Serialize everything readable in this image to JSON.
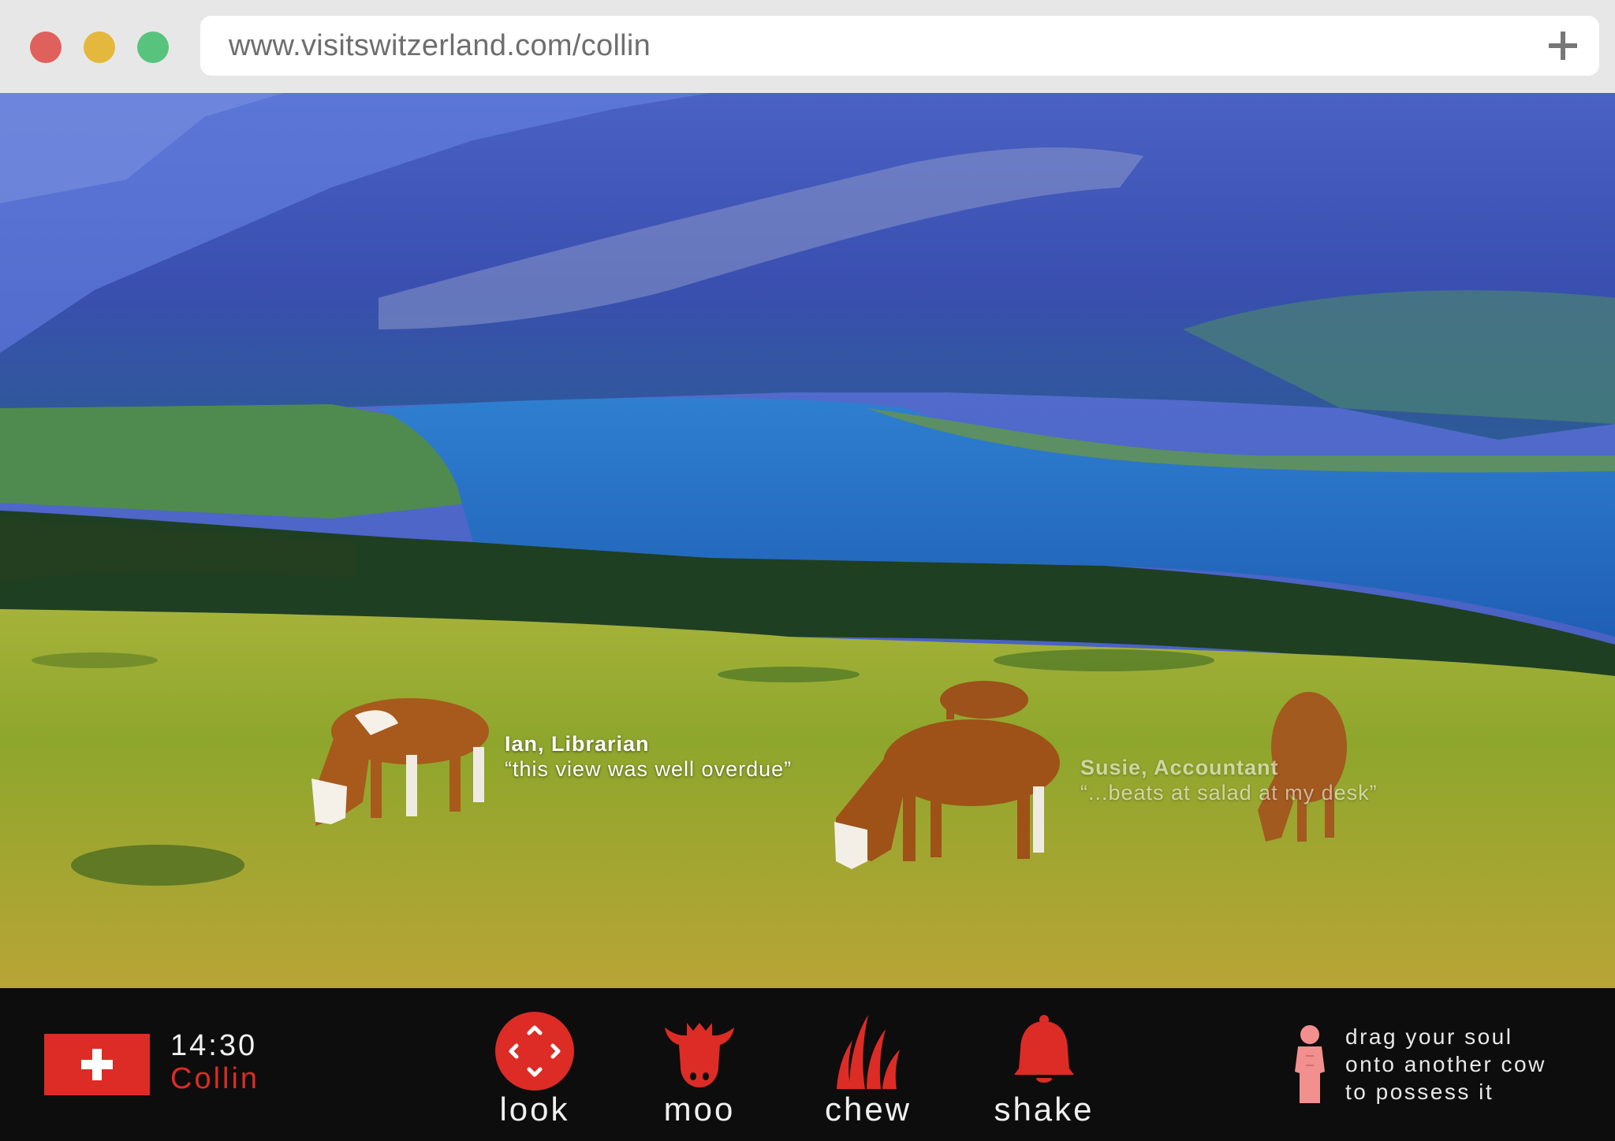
{
  "browser": {
    "url": "www.visitswitzerland.com/collin",
    "window_buttons": [
      "close",
      "minimize",
      "maximize"
    ],
    "new_tab_icon": "plus-icon"
  },
  "scene": {
    "captions": [
      {
        "name": "Ian, Librarian",
        "quote": "“this view was well overdue”"
      },
      {
        "name": "Susie, Accountant",
        "quote": "“...beats at salad at my desk”"
      }
    ]
  },
  "toolbar": {
    "flag_icon": "swiss-flag-icon",
    "time": "14:30",
    "user": "Collin",
    "actions": [
      {
        "label": "look",
        "icon": "look-target-icon"
      },
      {
        "label": "moo",
        "icon": "cow-head-icon"
      },
      {
        "label": "chew",
        "icon": "grass-icon"
      },
      {
        "label": "shake",
        "icon": "bell-icon"
      }
    ],
    "soul_icon": "soul-figure-icon",
    "hint_lines": [
      "drag your soul",
      "onto another cow",
      "to possess it"
    ]
  },
  "colors": {
    "accent_red": "#dc2c25",
    "toolbar_bg": "#0d0d0d",
    "chrome_bg": "#e7e7e7",
    "soul_pink": "#f28f8f"
  }
}
